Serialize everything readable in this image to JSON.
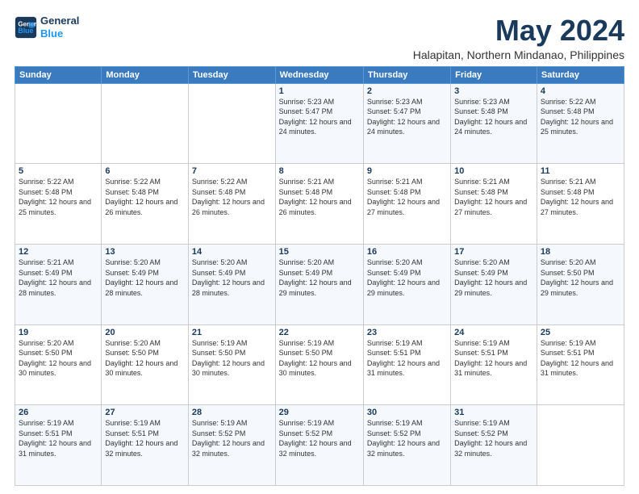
{
  "header": {
    "logo_line1": "General",
    "logo_line2": "Blue",
    "month": "May 2024",
    "location": "Halapitan, Northern Mindanao, Philippines"
  },
  "days_of_week": [
    "Sunday",
    "Monday",
    "Tuesday",
    "Wednesday",
    "Thursday",
    "Friday",
    "Saturday"
  ],
  "weeks": [
    [
      {
        "day": "",
        "info": ""
      },
      {
        "day": "",
        "info": ""
      },
      {
        "day": "",
        "info": ""
      },
      {
        "day": "1",
        "info": "Sunrise: 5:23 AM\nSunset: 5:47 PM\nDaylight: 12 hours\nand 24 minutes."
      },
      {
        "day": "2",
        "info": "Sunrise: 5:23 AM\nSunset: 5:47 PM\nDaylight: 12 hours\nand 24 minutes."
      },
      {
        "day": "3",
        "info": "Sunrise: 5:23 AM\nSunset: 5:48 PM\nDaylight: 12 hours\nand 24 minutes."
      },
      {
        "day": "4",
        "info": "Sunrise: 5:22 AM\nSunset: 5:48 PM\nDaylight: 12 hours\nand 25 minutes."
      }
    ],
    [
      {
        "day": "5",
        "info": "Sunrise: 5:22 AM\nSunset: 5:48 PM\nDaylight: 12 hours\nand 25 minutes."
      },
      {
        "day": "6",
        "info": "Sunrise: 5:22 AM\nSunset: 5:48 PM\nDaylight: 12 hours\nand 26 minutes."
      },
      {
        "day": "7",
        "info": "Sunrise: 5:22 AM\nSunset: 5:48 PM\nDaylight: 12 hours\nand 26 minutes."
      },
      {
        "day": "8",
        "info": "Sunrise: 5:21 AM\nSunset: 5:48 PM\nDaylight: 12 hours\nand 26 minutes."
      },
      {
        "day": "9",
        "info": "Sunrise: 5:21 AM\nSunset: 5:48 PM\nDaylight: 12 hours\nand 27 minutes."
      },
      {
        "day": "10",
        "info": "Sunrise: 5:21 AM\nSunset: 5:48 PM\nDaylight: 12 hours\nand 27 minutes."
      },
      {
        "day": "11",
        "info": "Sunrise: 5:21 AM\nSunset: 5:48 PM\nDaylight: 12 hours\nand 27 minutes."
      }
    ],
    [
      {
        "day": "12",
        "info": "Sunrise: 5:21 AM\nSunset: 5:49 PM\nDaylight: 12 hours\nand 28 minutes."
      },
      {
        "day": "13",
        "info": "Sunrise: 5:20 AM\nSunset: 5:49 PM\nDaylight: 12 hours\nand 28 minutes."
      },
      {
        "day": "14",
        "info": "Sunrise: 5:20 AM\nSunset: 5:49 PM\nDaylight: 12 hours\nand 28 minutes."
      },
      {
        "day": "15",
        "info": "Sunrise: 5:20 AM\nSunset: 5:49 PM\nDaylight: 12 hours\nand 29 minutes."
      },
      {
        "day": "16",
        "info": "Sunrise: 5:20 AM\nSunset: 5:49 PM\nDaylight: 12 hours\nand 29 minutes."
      },
      {
        "day": "17",
        "info": "Sunrise: 5:20 AM\nSunset: 5:49 PM\nDaylight: 12 hours\nand 29 minutes."
      },
      {
        "day": "18",
        "info": "Sunrise: 5:20 AM\nSunset: 5:50 PM\nDaylight: 12 hours\nand 29 minutes."
      }
    ],
    [
      {
        "day": "19",
        "info": "Sunrise: 5:20 AM\nSunset: 5:50 PM\nDaylight: 12 hours\nand 30 minutes."
      },
      {
        "day": "20",
        "info": "Sunrise: 5:20 AM\nSunset: 5:50 PM\nDaylight: 12 hours\nand 30 minutes."
      },
      {
        "day": "21",
        "info": "Sunrise: 5:19 AM\nSunset: 5:50 PM\nDaylight: 12 hours\nand 30 minutes."
      },
      {
        "day": "22",
        "info": "Sunrise: 5:19 AM\nSunset: 5:50 PM\nDaylight: 12 hours\nand 30 minutes."
      },
      {
        "day": "23",
        "info": "Sunrise: 5:19 AM\nSunset: 5:51 PM\nDaylight: 12 hours\nand 31 minutes."
      },
      {
        "day": "24",
        "info": "Sunrise: 5:19 AM\nSunset: 5:51 PM\nDaylight: 12 hours\nand 31 minutes."
      },
      {
        "day": "25",
        "info": "Sunrise: 5:19 AM\nSunset: 5:51 PM\nDaylight: 12 hours\nand 31 minutes."
      }
    ],
    [
      {
        "day": "26",
        "info": "Sunrise: 5:19 AM\nSunset: 5:51 PM\nDaylight: 12 hours\nand 31 minutes."
      },
      {
        "day": "27",
        "info": "Sunrise: 5:19 AM\nSunset: 5:51 PM\nDaylight: 12 hours\nand 32 minutes."
      },
      {
        "day": "28",
        "info": "Sunrise: 5:19 AM\nSunset: 5:52 PM\nDaylight: 12 hours\nand 32 minutes."
      },
      {
        "day": "29",
        "info": "Sunrise: 5:19 AM\nSunset: 5:52 PM\nDaylight: 12 hours\nand 32 minutes."
      },
      {
        "day": "30",
        "info": "Sunrise: 5:19 AM\nSunset: 5:52 PM\nDaylight: 12 hours\nand 32 minutes."
      },
      {
        "day": "31",
        "info": "Sunrise: 5:19 AM\nSunset: 5:52 PM\nDaylight: 12 hours\nand 32 minutes."
      },
      {
        "day": "",
        "info": ""
      }
    ]
  ]
}
